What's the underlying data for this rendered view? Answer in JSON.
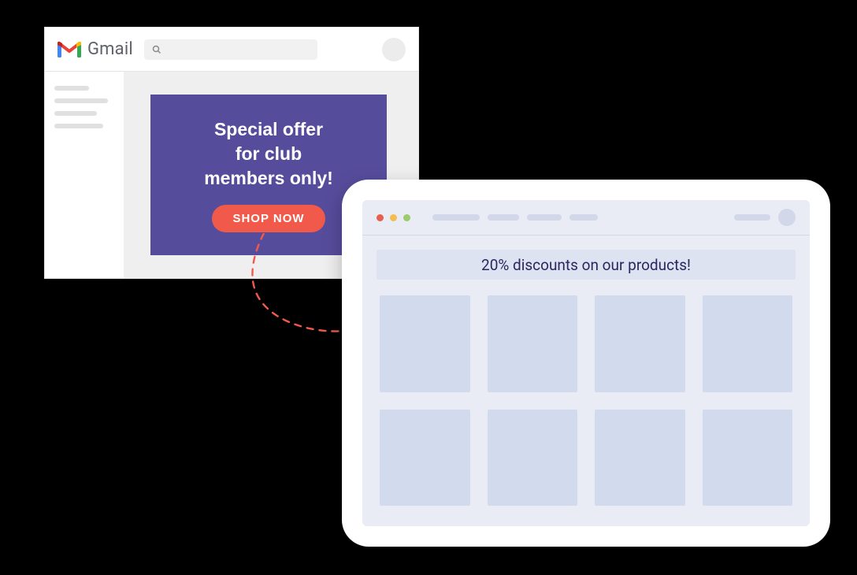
{
  "gmail": {
    "brand": "Gmail",
    "promo": {
      "line1": "Special offer",
      "line2": "for club",
      "line3": "members only!",
      "cta": "SHOP NOW"
    }
  },
  "landing": {
    "banner": "20% discounts on our products!"
  }
}
